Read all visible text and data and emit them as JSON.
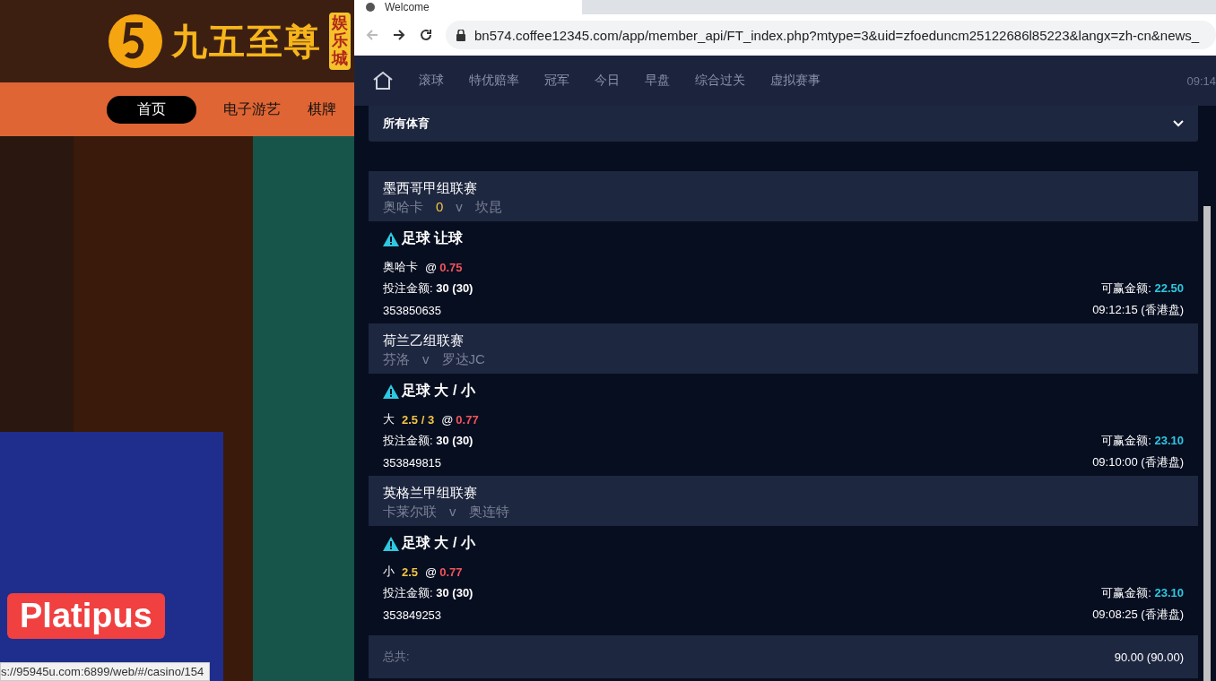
{
  "site": {
    "logo_text": "九五至尊",
    "logo_badge": "娱乐城",
    "nav": [
      {
        "label": "首页",
        "selected": true
      },
      {
        "label": "电子游艺",
        "selected": false
      },
      {
        "label": "棋牌",
        "selected": false
      }
    ],
    "promo": "Platipus",
    "status_url": "s://95945u.com:6899/web/#/casino/154"
  },
  "browser": {
    "tab_title": "Welcome",
    "url": "bn574.coffee12345.com/app/member_api/FT_index.php?mtype=3&uid=zfoeduncm25122686l85223&langx=zh-cn&news_"
  },
  "app": {
    "nav": [
      "滚球",
      "特优赔率",
      "冠军",
      "今日",
      "早盘",
      "综合过关",
      "虚拟赛事"
    ],
    "time": "09:14",
    "sport_filter": "所有体育",
    "bets": [
      {
        "league": "墨西哥甲组联赛",
        "home": "奥哈卡",
        "score": "0",
        "vs": "v",
        "away": "坎昆",
        "market": "足球 让球",
        "pick": "奥哈卡",
        "at": "@",
        "odds": "0.75",
        "stake_label": "投注金额:",
        "stake": "30 (30)",
        "win_label": "可赢金额:",
        "win": "22.50",
        "ticket": "353850635",
        "time": "09:12:15 (香港盘)"
      },
      {
        "league": "荷兰乙组联赛",
        "home": "芬洛",
        "vs": "v",
        "away": "罗达JC",
        "market": "足球 大 / 小",
        "pick": "大",
        "line": "2.5 / 3",
        "at": "@",
        "odds": "0.77",
        "stake_label": "投注金额:",
        "stake": "30 (30)",
        "win_label": "可赢金额:",
        "win": "23.10",
        "ticket": "353849815",
        "time": "09:10:00 (香港盘)"
      },
      {
        "league": "英格兰甲组联赛",
        "home": "卡莱尔联",
        "vs": "v",
        "away": "奥连特",
        "market": "足球 大 / 小",
        "pick": "小",
        "line": "2.5",
        "at": "@",
        "odds": "0.77",
        "stake_label": "投注金额:",
        "stake": "30 (30)",
        "win_label": "可赢金额:",
        "win": "23.10",
        "ticket": "353849253",
        "time": "09:08:25 (香港盘)"
      }
    ],
    "total_label": "总共:",
    "total": "90.00 (90.00)"
  }
}
